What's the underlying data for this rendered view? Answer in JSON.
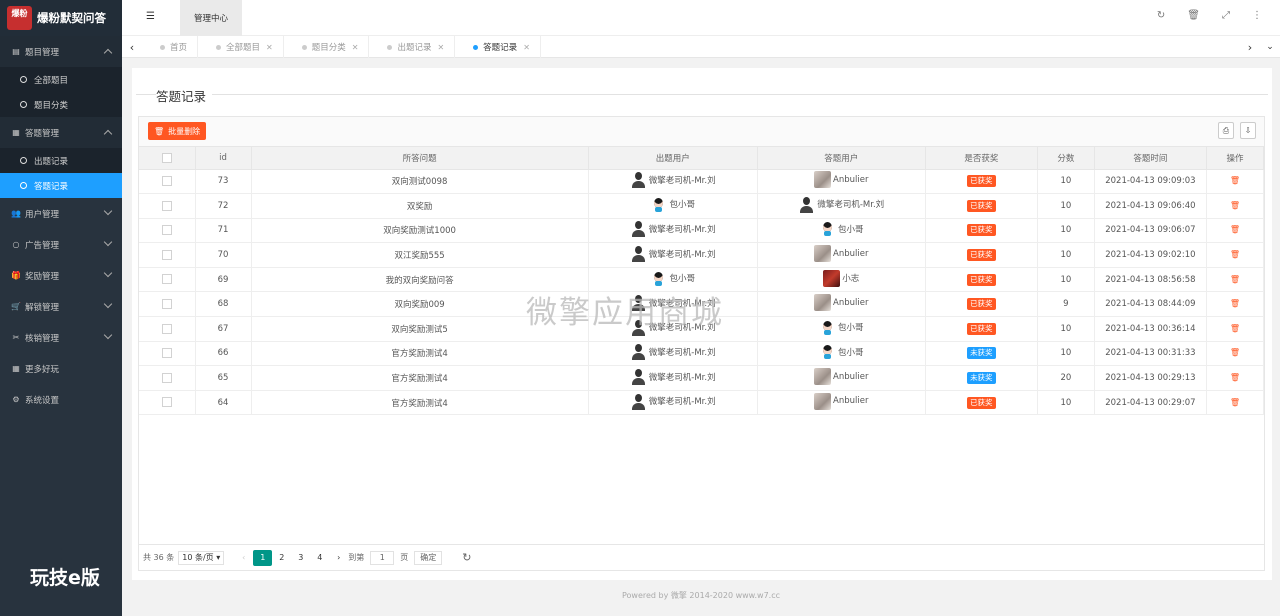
{
  "app": {
    "logo_badge": "爆粉",
    "logo_sub": "NUTRION",
    "title": "爆粉默契问答"
  },
  "sidebar": {
    "groups": [
      {
        "label": "题目管理",
        "icon": "book-icon",
        "open": true,
        "items": [
          {
            "label": "全部题目"
          },
          {
            "label": "题目分类"
          }
        ]
      },
      {
        "label": "答题管理",
        "icon": "calendar-icon",
        "open": true,
        "items": [
          {
            "label": "出题记录"
          },
          {
            "label": "答题记录",
            "active": true
          }
        ]
      },
      {
        "label": "用户管理",
        "icon": "users-icon"
      },
      {
        "label": "广告管理",
        "icon": "circle-icon"
      },
      {
        "label": "奖励管理",
        "icon": "gift-icon"
      },
      {
        "label": "解锁管理",
        "icon": "cart-icon"
      },
      {
        "label": "核销管理",
        "icon": "ticket-icon"
      },
      {
        "label": "更多好玩",
        "icon": "grid-icon"
      },
      {
        "label": "系统设置",
        "icon": "gear-icon"
      }
    ],
    "watermark": "玩技e版"
  },
  "topbar": {
    "tab": "管理中心"
  },
  "tabs": [
    {
      "label": "首页",
      "closable": false
    },
    {
      "label": "全部题目",
      "closable": true
    },
    {
      "label": "题目分类",
      "closable": true
    },
    {
      "label": "出题记录",
      "closable": true
    },
    {
      "label": "答题记录",
      "closable": true,
      "active": true
    }
  ],
  "page": {
    "title": "答题记录",
    "batch_delete": "批量删除"
  },
  "table": {
    "headers": [
      "id",
      "所答问题",
      "出题用户",
      "答题用户",
      "是否获奖",
      "分数",
      "答题时间",
      "操作"
    ],
    "rows": [
      {
        "id": "73",
        "question": "双向测试0098",
        "asker": "微擎老司机-Mr.刘",
        "asker_av": "man",
        "answerer": "Anbulier",
        "answerer_av": "cat",
        "award": "已获奖",
        "award_color": "#ff5722",
        "score": "10",
        "time": "2021-04-13 09:09:03"
      },
      {
        "id": "72",
        "question": "双奖励",
        "asker": "包小哥",
        "asker_av": "kid",
        "answerer": "微擎老司机-Mr.刘",
        "answerer_av": "man",
        "award": "已获奖",
        "award_color": "#ff5722",
        "score": "10",
        "time": "2021-04-13 09:06:40"
      },
      {
        "id": "71",
        "question": "双向奖励测试1000",
        "asker": "微擎老司机-Mr.刘",
        "asker_av": "man",
        "answerer": "包小哥",
        "answerer_av": "kid",
        "award": "已获奖",
        "award_color": "#ff5722",
        "score": "10",
        "time": "2021-04-13 09:06:07"
      },
      {
        "id": "70",
        "question": "双江奖励555",
        "asker": "微擎老司机-Mr.刘",
        "asker_av": "man",
        "answerer": "Anbulier",
        "answerer_av": "cat",
        "award": "已获奖",
        "award_color": "#ff5722",
        "score": "10",
        "time": "2021-04-13 09:02:10"
      },
      {
        "id": "69",
        "question": "我的双向奖励问答",
        "asker": "包小哥",
        "asker_av": "kid",
        "answerer": "小志",
        "answerer_av": "girl",
        "award": "已获奖",
        "award_color": "#ff5722",
        "score": "10",
        "time": "2021-04-13 08:56:58"
      },
      {
        "id": "68",
        "question": "双向奖励009",
        "asker": "微擎老司机-Mr.刘",
        "asker_av": "man",
        "answerer": "Anbulier",
        "answerer_av": "cat",
        "award": "已获奖",
        "award_color": "#ff5722",
        "score": "9",
        "time": "2021-04-13 08:44:09"
      },
      {
        "id": "67",
        "question": "双向奖励测试5",
        "asker": "微擎老司机-Mr.刘",
        "asker_av": "man",
        "answerer": "包小哥",
        "answerer_av": "kid",
        "award": "已获奖",
        "award_color": "#ff5722",
        "score": "10",
        "time": "2021-04-13 00:36:14"
      },
      {
        "id": "66",
        "question": "官方奖励测试4",
        "asker": "微擎老司机-Mr.刘",
        "asker_av": "man",
        "answerer": "包小哥",
        "answerer_av": "kid",
        "award": "未获奖",
        "award_color": "#1e9fff",
        "score": "10",
        "time": "2021-04-13 00:31:33"
      },
      {
        "id": "65",
        "question": "官方奖励测试4",
        "asker": "微擎老司机-Mr.刘",
        "asker_av": "man",
        "answerer": "Anbulier",
        "answerer_av": "cat",
        "award": "未获奖",
        "award_color": "#1e9fff",
        "score": "20",
        "time": "2021-04-13 00:29:13"
      },
      {
        "id": "64",
        "question": "官方奖励测试4",
        "asker": "微擎老司机-Mr.刘",
        "asker_av": "man",
        "answerer": "Anbulier",
        "answerer_av": "cat",
        "award": "已获奖",
        "award_color": "#ff5722",
        "score": "10",
        "time": "2021-04-13 00:29:07"
      }
    ]
  },
  "pager": {
    "total": "共 36 条",
    "page_size": "10 条/页",
    "pages": [
      "1",
      "2",
      "3",
      "4"
    ],
    "current": "1",
    "goto_label": "到第",
    "goto_value": "1",
    "page_unit": "页",
    "confirm": "确定"
  },
  "watermark": "微擎应用商城",
  "footer": "Powered by 微擎 2014-2020 www.w7.cc"
}
